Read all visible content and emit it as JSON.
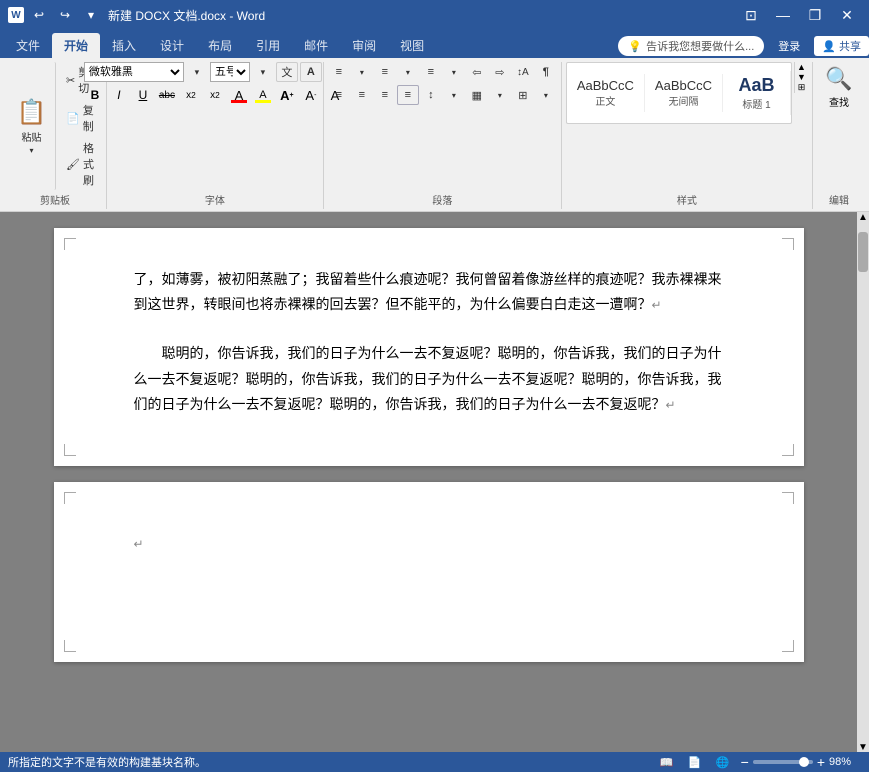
{
  "titlebar": {
    "app_icon": "W",
    "title": "新建 DOCX 文档.docx - Word",
    "quick_access": [
      "undo",
      "redo",
      "customize"
    ],
    "controls": [
      "minimize",
      "restore",
      "close"
    ]
  },
  "ribbon": {
    "tabs": [
      "文件",
      "开始",
      "插入",
      "设计",
      "布局",
      "引用",
      "邮件",
      "审阅",
      "视图"
    ],
    "active_tab": "开始",
    "tell_me": "告诉我您想要做什么...",
    "user_btn": "登录",
    "share_btn": "共享"
  },
  "toolbar": {
    "groups": {
      "clipboard": {
        "label": "剪贴板",
        "paste_label": "粘贴",
        "cut_label": "剪切",
        "copy_label": "复制",
        "format_painter": "格式刷"
      },
      "font": {
        "label": "字体",
        "font_name": "微软雅黑",
        "font_size": "五号",
        "bold": "B",
        "italic": "I",
        "underline": "U",
        "strikethrough": "abc",
        "subscript": "x₂",
        "superscript": "x²",
        "font_color": "A",
        "highlight": "A",
        "grow": "A",
        "shrink": "A"
      },
      "paragraph": {
        "label": "段落",
        "bullets": "≡",
        "numbering": "≡",
        "multilevel": "≡",
        "decrease_indent": "⇐",
        "increase_indent": "⇒",
        "sort": "↕A",
        "show_marks": "¶",
        "align_left": "≡",
        "align_center": "≡",
        "align_right": "≡",
        "justify": "≡",
        "line_spacing": "↕",
        "shading": "▦",
        "borders": "⊞"
      },
      "styles": {
        "label": "样式",
        "items": [
          {
            "name": "正文",
            "preview": "AaBbCcC",
            "type": "normal"
          },
          {
            "name": "无间隔",
            "preview": "AaBbCcC",
            "type": "no-spacing"
          },
          {
            "name": "标题 1",
            "preview": "AaB",
            "type": "heading1"
          }
        ]
      },
      "editing": {
        "label": "编辑",
        "search": "查找"
      }
    }
  },
  "document": {
    "pages": [
      {
        "id": "page1",
        "paragraphs": [
          "了，如薄雾，被初阳蒸融了；我留着些什么痕迹呢？我何曾留着像游丝样的痕迹呢？我赤裸裸来到这世界，转眼间也将赤裸裸的回去罢？但不能平的，为什么偏要白白走这一遭啊？↵",
          "",
          "　　聪明的，你告诉我，我们的日子为什么一去不复返呢？聪明的，你告诉我，我们的日子为什么一去不复返呢？聪明的，你告诉我，我们的日子为什么一去不复返呢？聪明的，你告诉我，我们的日子为什么一去不复返呢？聪明的，你告诉我，我们的日子为什么一去不复返呢？↵"
        ]
      },
      {
        "id": "page2",
        "paragraphs": [
          "↵"
        ]
      }
    ]
  },
  "statusbar": {
    "hint": "所指定的文字不是有效的构建基块名称。",
    "page_info": "",
    "zoom_percent": "98%",
    "view_modes": [
      "阅读视图",
      "页面视图",
      "web视图"
    ]
  }
}
